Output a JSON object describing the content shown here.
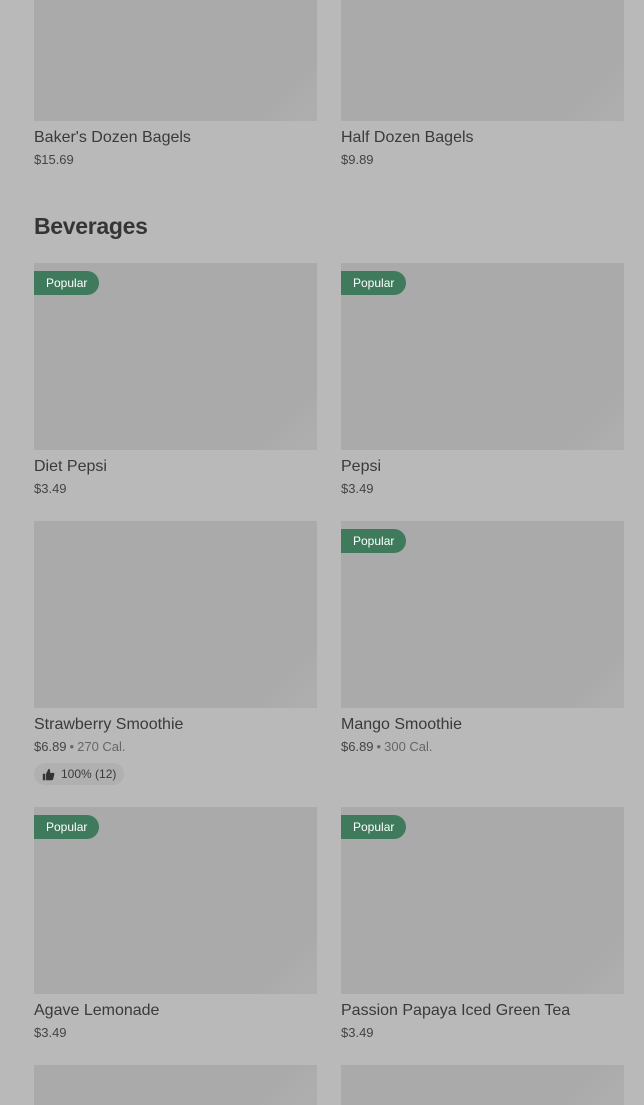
{
  "bagels": [
    {
      "name": "Baker's Dozen Bagels",
      "price": "$15.69"
    },
    {
      "name": "Half Dozen Bagels",
      "price": "$9.89"
    }
  ],
  "section": {
    "title": "Beverages"
  },
  "beverages": [
    {
      "name": "Diet Pepsi",
      "price": "$3.49",
      "badge": "Popular"
    },
    {
      "name": "Pepsi",
      "price": "$3.49",
      "badge": "Popular"
    },
    {
      "name": "Strawberry Smoothie",
      "price": "$6.89",
      "separator": "•",
      "calories": "270 Cal.",
      "rating": "100% (12)"
    },
    {
      "name": "Mango Smoothie",
      "price": "$6.89",
      "separator": "•",
      "calories": "300 Cal.",
      "badge": "Popular"
    },
    {
      "name": "Agave Lemonade",
      "price": "$3.49",
      "badge": "Popular"
    },
    {
      "name": "Passion Papaya Iced Green Tea",
      "price": "$3.49",
      "badge": "Popular"
    }
  ],
  "icons": {
    "rating": "thumbs-up-icon"
  },
  "colors": {
    "badge": "#3e7a5b",
    "background": "#b9b9b9",
    "image_placeholder": "#aaaaaa"
  }
}
